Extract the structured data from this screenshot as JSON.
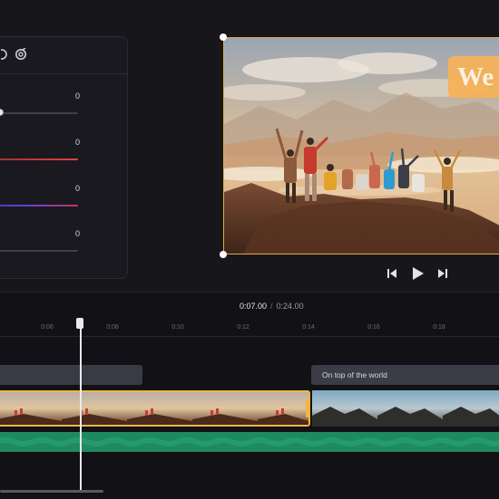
{
  "adjust_panel": {
    "sliders": [
      {
        "name": "slider-1",
        "value": "0",
        "track_color": "#3f3e46"
      },
      {
        "name": "slider-2",
        "value": "0",
        "track_color": "#c8443f"
      },
      {
        "name": "slider-3",
        "value": "0",
        "track_color": "#5b3fd0"
      },
      {
        "name": "slider-4",
        "value": "0",
        "track_color": "#3f3e46"
      }
    ]
  },
  "preview": {
    "title_text": "We",
    "selection_color": "#e3a93c"
  },
  "playback": {
    "prev_icon": "skip-back-icon",
    "play_icon": "play-icon",
    "next_icon": "skip-forward-icon"
  },
  "timeline": {
    "current_time": "0:07.00",
    "separator": "/",
    "total_time": "0:24.00",
    "ticks": [
      "0:06",
      "0:08",
      "0:10",
      "0:12",
      "0:14",
      "0:16",
      "0:18"
    ],
    "text_clip_label": "On top of the world",
    "audio_color": "#1f8a5f",
    "clip_selection_color": "#f0b640"
  }
}
